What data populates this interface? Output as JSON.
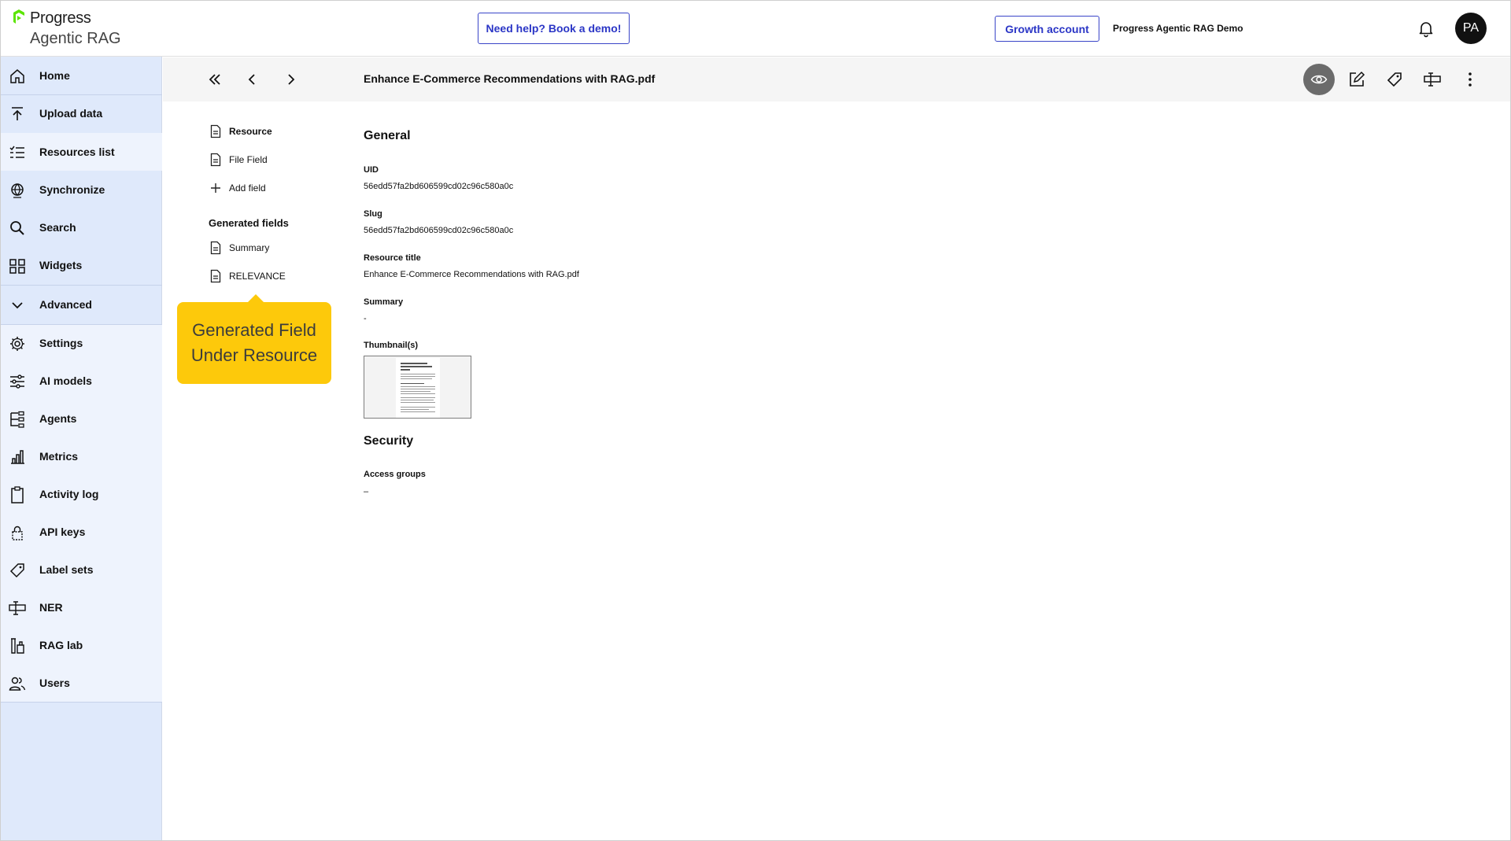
{
  "topbar": {
    "brand": "Progress",
    "product": "Agentic RAG",
    "demo_button": "Need help? Book a demo!",
    "account_button": "Growth account",
    "kb_name": "Progress Agentic RAG Demo",
    "avatar_initials": "PA"
  },
  "sidebar": {
    "items": [
      {
        "label": "Home",
        "icon": "home-icon"
      },
      {
        "label": "Upload data",
        "icon": "upload-icon"
      },
      {
        "label": "Resources list",
        "icon": "list-icon"
      },
      {
        "label": "Synchronize",
        "icon": "globe-icon"
      },
      {
        "label": "Search",
        "icon": "search-icon"
      },
      {
        "label": "Widgets",
        "icon": "widgets-icon"
      },
      {
        "label": "Advanced",
        "icon": "chevron-down-icon"
      },
      {
        "label": "Settings",
        "icon": "gear-icon"
      },
      {
        "label": "AI models",
        "icon": "sliders-icon"
      },
      {
        "label": "Agents",
        "icon": "agents-icon"
      },
      {
        "label": "Metrics",
        "icon": "bar-chart-icon"
      },
      {
        "label": "Activity log",
        "icon": "clipboard-icon"
      },
      {
        "label": "API keys",
        "icon": "lock-icon"
      },
      {
        "label": "Label sets",
        "icon": "tag-icon"
      },
      {
        "label": "NER",
        "icon": "ner-icon"
      },
      {
        "label": "RAG lab",
        "icon": "flask-icon"
      },
      {
        "label": "Users",
        "icon": "users-icon"
      }
    ]
  },
  "viewer": {
    "title": "Enhance E-Commerce Recommendations with RAG.pdf",
    "toolbar_icons": [
      "eye-icon",
      "edit-icon",
      "tag-icon",
      "ner-icon",
      "more-vertical-icon"
    ]
  },
  "fields": {
    "items": [
      {
        "label": "Resource",
        "icon": "document-icon",
        "selected": true
      },
      {
        "label": "File Field",
        "icon": "document-icon"
      },
      {
        "label": "Add field",
        "icon": "plus-icon"
      }
    ],
    "generated_title": "Generated fields",
    "generated": [
      {
        "label": "Summary",
        "icon": "document-icon"
      },
      {
        "label": "RELEVANCE",
        "icon": "document-icon"
      }
    ]
  },
  "callout": {
    "line1": "Generated Field",
    "line2": "Under Resource",
    "color": "#fdc90b"
  },
  "general": {
    "heading": "General",
    "uid_label": "UID",
    "uid_value": "56edd57fa2bd606599cd02c96c580a0c",
    "slug_label": "Slug",
    "slug_value": "56edd57fa2bd606599cd02c96c580a0c",
    "title_label": "Resource title",
    "title_value": "Enhance E-Commerce Recommendations with RAG.pdf",
    "summary_label": "Summary",
    "summary_value": "-",
    "thumbnail_label": "Thumbnail(s)"
  },
  "security": {
    "heading": "Security",
    "access_label": "Access groups",
    "access_value": "–"
  },
  "colors": {
    "accent": "#2b36c6",
    "sidebar_bg": "#dfe9fb",
    "callout": "#fdc90b"
  }
}
